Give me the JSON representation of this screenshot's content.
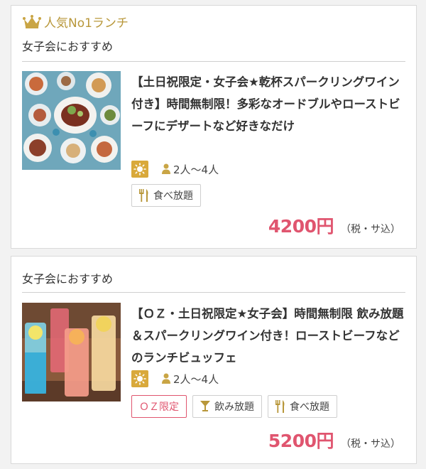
{
  "cards": [
    {
      "rank_label": "人気No1ランチ",
      "tagline": "女子会におすすめ",
      "title": "【土日祝限定・女子会★乾杯スパークリングワイン付き】時間無制限！多彩なオードブルやローストビーフにデザートなど好きなだけ",
      "people": "2人〜4人",
      "tags": [
        "食べ放題"
      ],
      "price": "4200円",
      "tax_note": "（税・サ込）",
      "thumb_icon": "buffet-food-photo"
    },
    {
      "tagline": "女子会におすすめ",
      "title": "【ＯＺ・土日祝限定★女子会】時間無制限 飲み放題＆スパークリングワイン付き！ローストビーフなどのランチビュッフェ",
      "people": "2人〜4人",
      "tags": [
        "ＯＺ限定",
        "飲み放題",
        "食べ放題"
      ],
      "price": "5200円",
      "tax_note": "（税・サ込）",
      "thumb_icon": "cocktail-drinks-photo"
    }
  ],
  "colors": {
    "accent_pink": "#e0556f",
    "gold": "#b8973a",
    "sun_badge": "#d9a93b"
  },
  "icons": [
    "crown-icon",
    "sun-icon",
    "person-icon",
    "fork-knife-icon",
    "cocktail-glass-icon"
  ]
}
